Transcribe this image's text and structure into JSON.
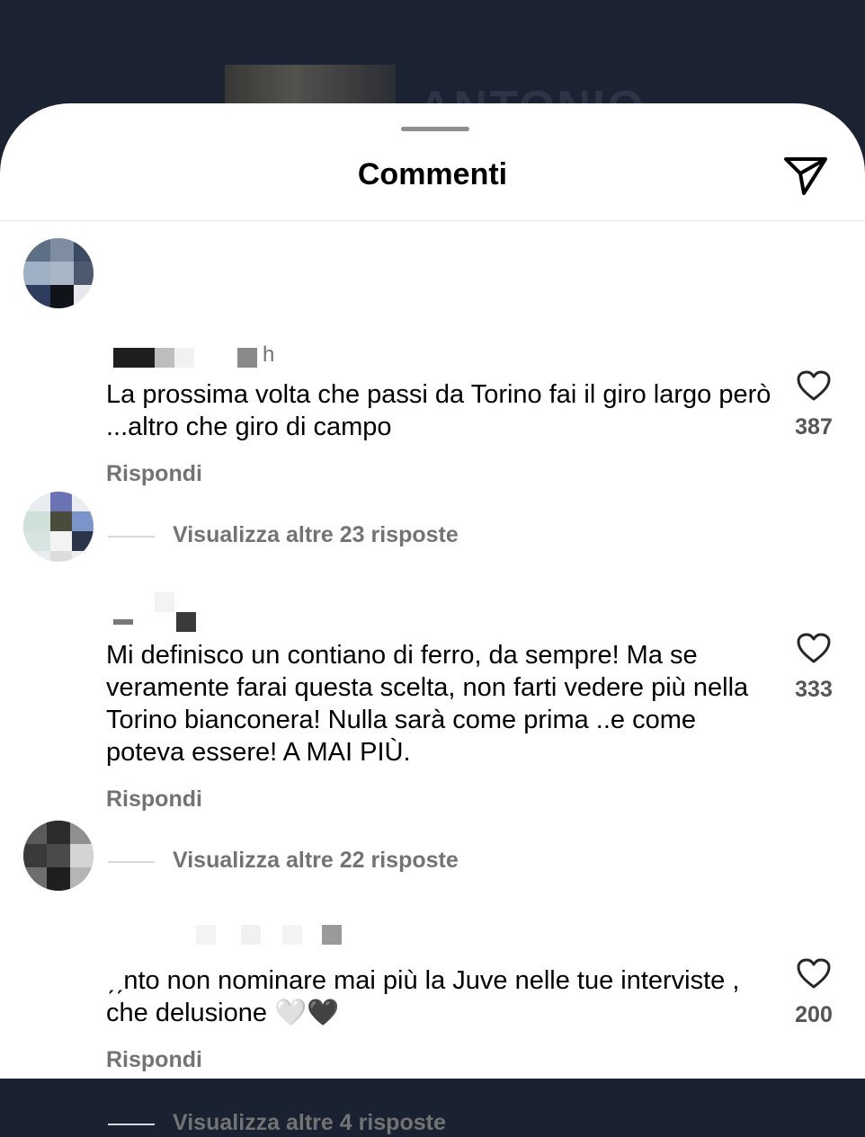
{
  "background": {
    "partial_title": "ANTONIO"
  },
  "sheet": {
    "title": "Commenti",
    "share_icon": "paper-plane-icon"
  },
  "comments": [
    {
      "username": "",
      "time": "h",
      "text": "La prossima volta che passi da Torino fai il giro largo però ...altro che giro di campo",
      "reply_label": "Rispondi",
      "more_replies_label": "Visualizza altre 23 risposte",
      "likes": "387",
      "like_icon": "heart-outline-icon"
    },
    {
      "username": "",
      "time": "",
      "text": "Mi definisco un contiano di ferro, da sempre! Ma se veramente farai questa scelta, non farti vedere più nella Torino bianconera! Nulla sarà come prima ..e come poteva essere! A MAI PIÙ.",
      "reply_label": "Rispondi",
      "more_replies_label": "Visualizza altre 22 risposte",
      "likes": "333",
      "like_icon": "heart-outline-icon"
    },
    {
      "username": "",
      "time": "",
      "text": "ˏˏnto non nominare mai più la Juve nelle tue interviste , che delusione 🤍🖤",
      "reply_label": "Rispondi",
      "more_replies_label": "Visualizza altre 4 risposte",
      "likes": "200",
      "like_icon": "heart-outline-icon"
    }
  ]
}
